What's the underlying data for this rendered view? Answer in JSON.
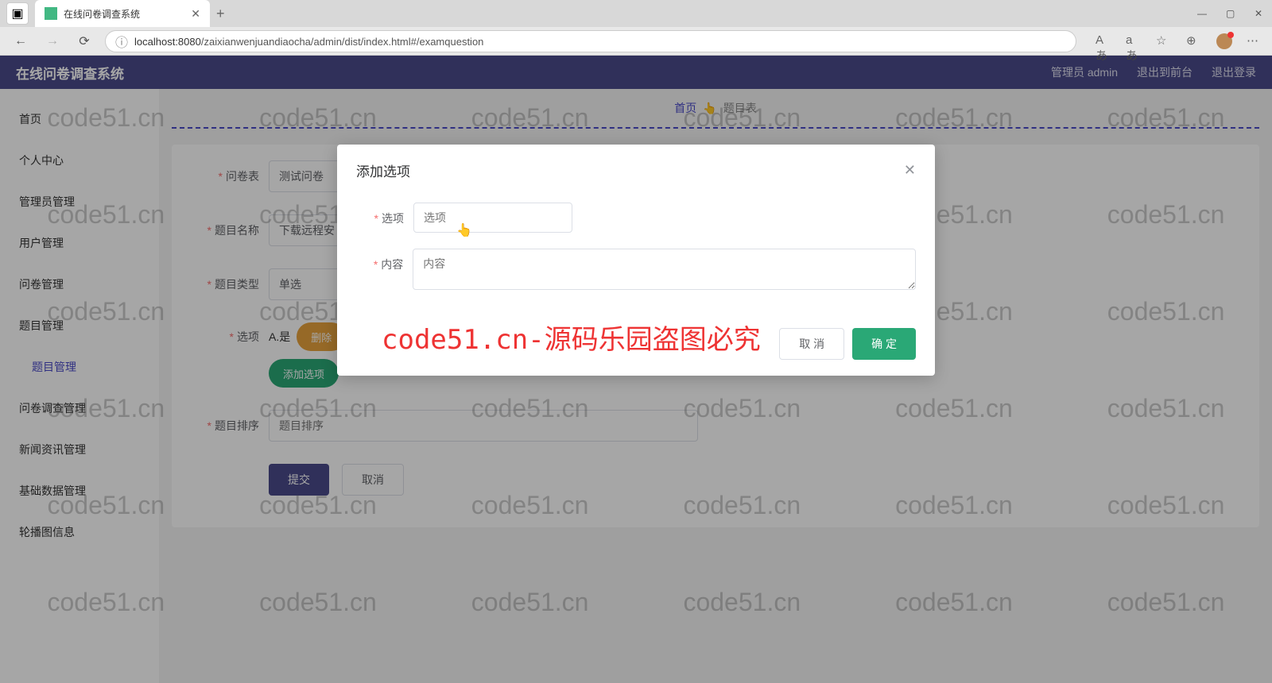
{
  "browser": {
    "tab_title": "在线问卷调查系统",
    "url_host": "localhost:8080",
    "url_path": "/zaixianwenjuandiaocha/admin/dist/index.html#/examquestion"
  },
  "header": {
    "app_title": "在线问卷调查系统",
    "user_label": "管理员 admin",
    "front_link": "退出到前台",
    "logout_link": "退出登录"
  },
  "sidebar": {
    "items": [
      {
        "label": "首页"
      },
      {
        "label": "个人中心"
      },
      {
        "label": "管理员管理"
      },
      {
        "label": "用户管理"
      },
      {
        "label": "问卷管理"
      },
      {
        "label": "题目管理"
      },
      {
        "label": "题目管理",
        "active": true
      },
      {
        "label": "问卷调查管理"
      },
      {
        "label": "新闻资讯管理"
      },
      {
        "label": "基础数据管理"
      },
      {
        "label": "轮播图信息"
      }
    ]
  },
  "breadcrumb": {
    "home": "首页",
    "current": "题目表"
  },
  "form": {
    "questionnaire_label": "问卷表",
    "questionnaire_value": "测试问卷",
    "name_label": "题目名称",
    "name_value": "下载远程安",
    "type_label": "题目类型",
    "type_value": "单选",
    "option_label": "选项",
    "option_a": "A.是",
    "delete_btn": "删除",
    "add_option_btn": "添加选项",
    "sort_label": "题目排序",
    "sort_placeholder": "题目排序",
    "submit_btn": "提交",
    "cancel_btn": "取消"
  },
  "modal": {
    "title": "添加选项",
    "option_label": "选项",
    "option_placeholder": "选项",
    "content_label": "内容",
    "content_placeholder": "内容",
    "cancel_btn": "取 消",
    "confirm_btn": "确 定"
  },
  "watermark": {
    "text": "code51.cn",
    "red_text": "code51.cn-源码乐园盗图必究"
  }
}
